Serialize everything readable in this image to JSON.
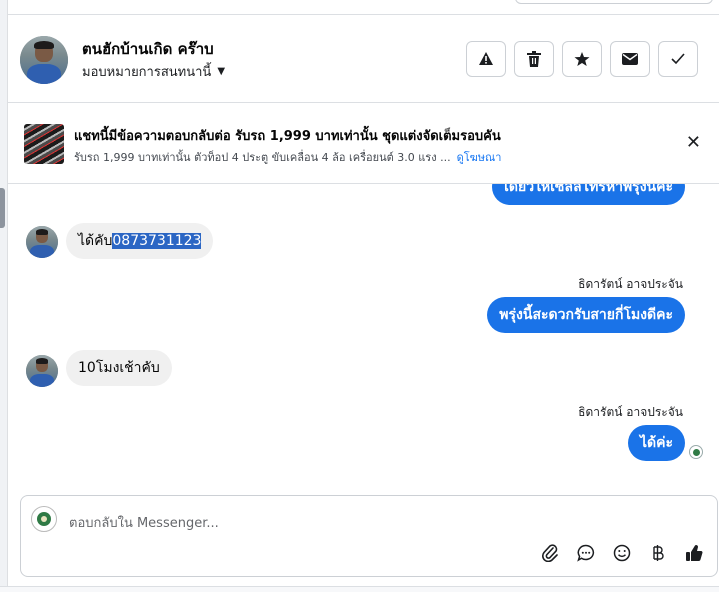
{
  "header": {
    "name": "ตนฮักบ้านเกิด คร๊าบ",
    "assign": "มอบหมายการสนทนานี้",
    "actions": [
      "warning-icon",
      "trash-icon",
      "star-icon",
      "envelope-icon",
      "check-icon"
    ]
  },
  "ad": {
    "title": "แชทนี้มีข้อความตอบกลับต่อ รับรถ 1,999 บาทเท่านั้น ชุดแต่งจัดเต็มรอบคัน",
    "subtitle": "รับรถ 1,999 บาทเท่านั้น ตัวท็อป 4 ประตู ขับเคลื่อน 4 ล้อ เครื่อยนต์ 3.0 แรง ...",
    "link": "ดูโฆษณา",
    "close": "✕"
  },
  "messages": {
    "m0": "เดี๋ยวให้เซลล์โทรหาพรุ่งนี้ค่ะ",
    "m1_prefix": "ได้คับ",
    "m1_selected": "0873731123",
    "m2_sender": "ธิดารัตน์ อาจประจัน",
    "m2": "พรุ่งนี้สะดวกรับสายกี่โมงดีคะ",
    "m3": "10โมงเช้าคับ",
    "m4_sender": "ธิดารัตน์ อาจประจัน",
    "m4": "ได้ค่ะ"
  },
  "composer": {
    "placeholder": "ตอบกลับใน Messenger...",
    "tools": [
      "paperclip-icon",
      "chat-bubble-icon",
      "smiley-icon",
      "baht-icon",
      "thumbs-up-icon"
    ]
  },
  "colors": {
    "outgoing_bubble": "#1a73e8",
    "incoming_bubble": "#f0f0f0",
    "link": "#1877f2"
  }
}
